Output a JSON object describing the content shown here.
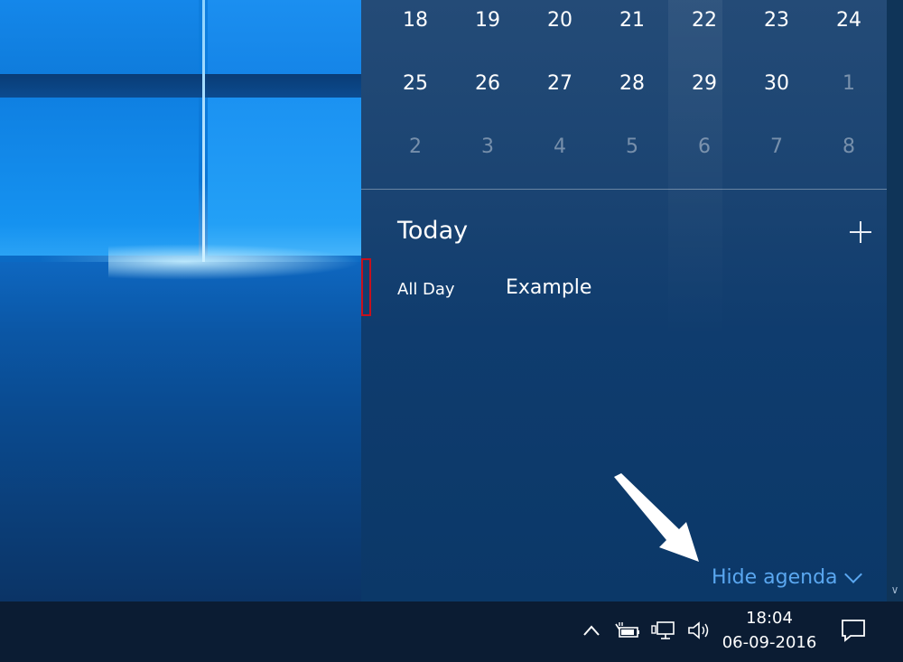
{
  "calendar": {
    "week1": [
      {
        "label": "18",
        "dim": false
      },
      {
        "label": "19",
        "dim": false
      },
      {
        "label": "20",
        "dim": false
      },
      {
        "label": "21",
        "dim": false
      },
      {
        "label": "22",
        "dim": false
      },
      {
        "label": "23",
        "dim": false
      },
      {
        "label": "24",
        "dim": false
      }
    ],
    "week2": [
      {
        "label": "25",
        "dim": false
      },
      {
        "label": "26",
        "dim": false
      },
      {
        "label": "27",
        "dim": false
      },
      {
        "label": "28",
        "dim": false
      },
      {
        "label": "29",
        "dim": false
      },
      {
        "label": "30",
        "dim": false
      },
      {
        "label": "1",
        "dim": true
      }
    ],
    "week3": [
      {
        "label": "2",
        "dim": true
      },
      {
        "label": "3",
        "dim": true
      },
      {
        "label": "4",
        "dim": true
      },
      {
        "label": "5",
        "dim": true
      },
      {
        "label": "6",
        "dim": true
      },
      {
        "label": "7",
        "dim": true
      },
      {
        "label": "8",
        "dim": true
      }
    ]
  },
  "agenda": {
    "title": "Today",
    "events": [
      {
        "time": "All Day",
        "title": "Example"
      }
    ],
    "hide_label": "Hide agenda"
  },
  "taskbar": {
    "time": "18:04",
    "date": "06-09-2016",
    "tray_icons": [
      "chevron-up-icon",
      "power-icon",
      "network-icon",
      "volume-icon",
      "action-center-icon"
    ]
  },
  "colors": {
    "accent_link": "#5aa7f0",
    "event_marker": "#c8101c",
    "taskbar": "#0b1c33"
  }
}
